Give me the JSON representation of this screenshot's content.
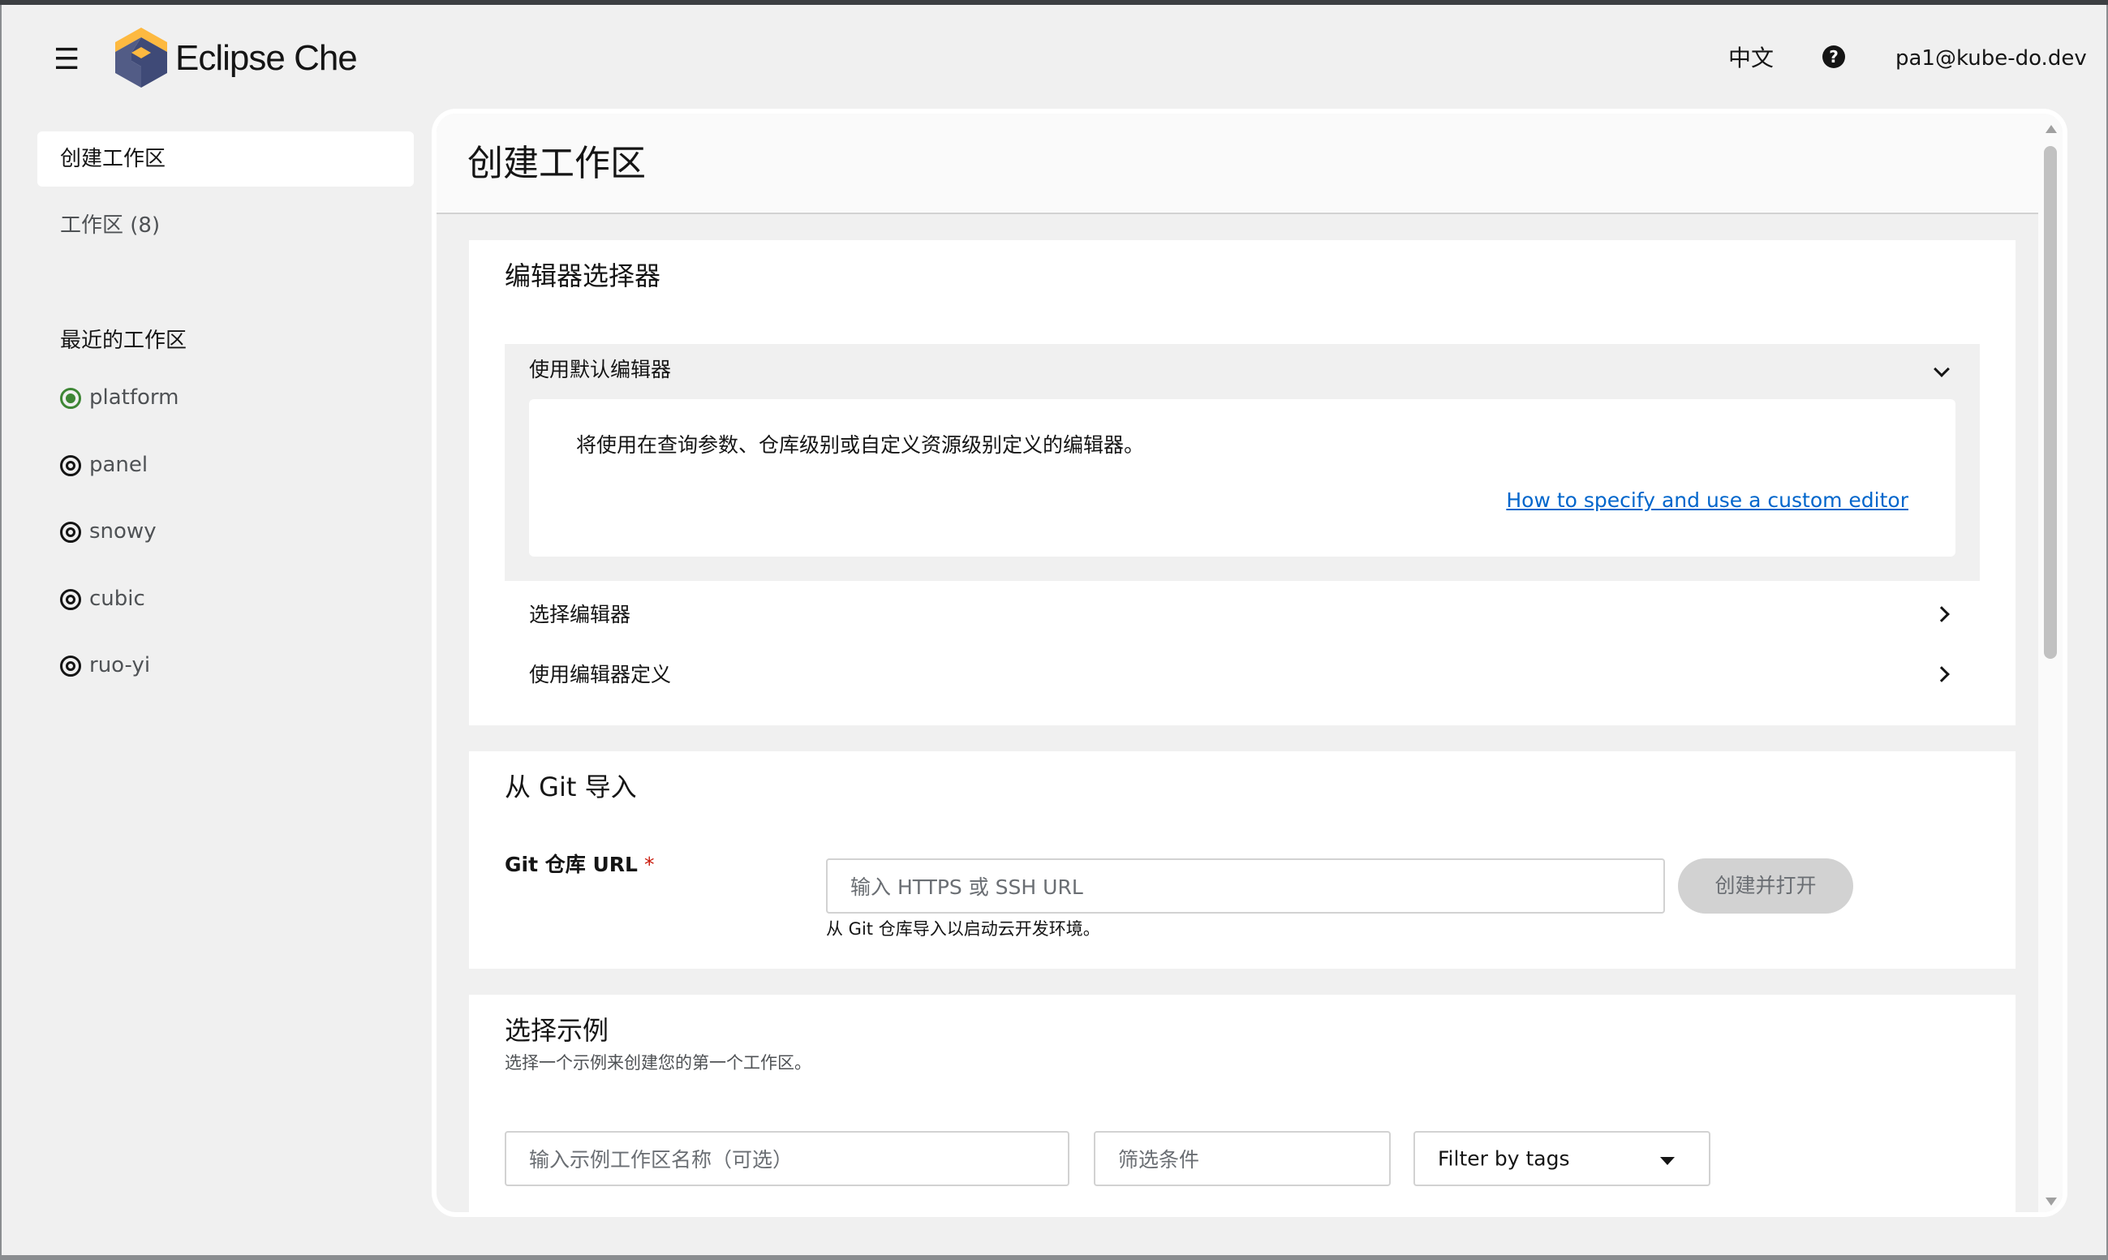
{
  "header": {
    "brand": "Eclipse Che",
    "language": "中文",
    "help_glyph": "?",
    "user": "pa1@kube-do.dev"
  },
  "sidebar": {
    "create_workspace": "创建工作区",
    "workspaces": "工作区 (8)",
    "recent_title": "最近的工作区",
    "recent": [
      {
        "name": "platform",
        "status": "running"
      },
      {
        "name": "panel",
        "status": "stopped"
      },
      {
        "name": "snowy",
        "status": "stopped"
      },
      {
        "name": "cubic",
        "status": "stopped"
      },
      {
        "name": "ruo-yi",
        "status": "stopped"
      }
    ]
  },
  "main": {
    "title": "创建工作区",
    "editor_selector": {
      "title": "编辑器选择器",
      "default_editor": "使用默认编辑器",
      "default_text": "将使用在查询参数、仓库级别或自定义资源级别定义的编辑器。",
      "custom_editor_link": "How to specify and use a custom editor",
      "choose_editor": "选择编辑器",
      "editor_definition": "使用编辑器定义"
    },
    "git_import": {
      "title": "从 Git 导入",
      "label": "Git 仓库 URL",
      "required_mark": "*",
      "placeholder": "输入 HTTPS 或 SSH URL",
      "button": "创建并打开",
      "helper": "从 Git 仓库导入以启动云开发环境。"
    },
    "samples": {
      "title": "选择示例",
      "subtitle": "选择一个示例来创建您的第一个工作区。",
      "name_placeholder": "输入示例工作区名称（可选）",
      "filter_placeholder": "筛选条件",
      "tags_select": "Filter by tags"
    }
  },
  "colors": {
    "accent_link": "#0066cc",
    "running": "#3e8635",
    "required": "#c9190b",
    "logo_top": "#fdb940",
    "logo_left": "#525c86",
    "logo_right": "#3f4a77"
  }
}
